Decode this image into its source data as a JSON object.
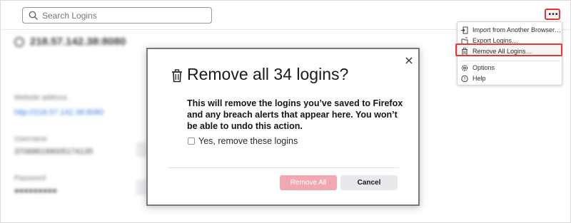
{
  "search": {
    "placeholder": "Search Logins"
  },
  "menu_button": {
    "label": "…"
  },
  "background": {
    "site_title": "218.57.142.38:8080",
    "website_label": "Website address",
    "website_value": "http://218.57.142.38:8080",
    "username_label": "Username",
    "username_value": "370686199005174135",
    "password_label": "Password",
    "password_value": "●●●●●●●●●"
  },
  "dropdown": {
    "items": [
      {
        "label": "Import from Another Browser…",
        "icon": "import-icon"
      },
      {
        "label": "Export Logins…",
        "icon": "export-icon"
      },
      {
        "label": "Remove All Logins…",
        "icon": "trash-icon"
      },
      {
        "label": "Options",
        "icon": "gear-icon"
      },
      {
        "label": "Help",
        "icon": "help-icon"
      }
    ]
  },
  "dialog": {
    "title": "Remove all 34 logins?",
    "message": "This will remove the logins you’ve saved to Firefox and any breach alerts that appear here. You won’t be able to undo this action.",
    "checkbox_label": "Yes, remove these logins",
    "remove_label": "Remove All",
    "cancel_label": "Cancel",
    "close_label": "×"
  },
  "colors": {
    "highlight": "#e22828",
    "remove_button_disabled": "#f2a8b3",
    "cancel_button": "#e9e9ed"
  }
}
